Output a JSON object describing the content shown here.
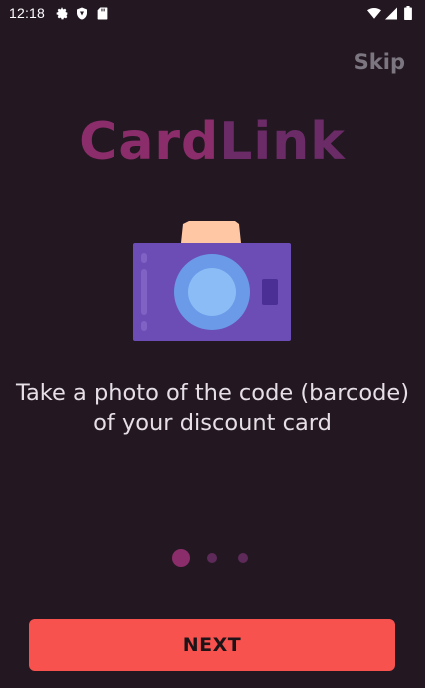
{
  "status_bar": {
    "time": "12:18",
    "left_icons": [
      "gear-icon",
      "shield-icon",
      "sd-card-icon"
    ],
    "right_icons": [
      "wifi-icon",
      "signal-icon",
      "battery-icon"
    ]
  },
  "header": {
    "skip_label": "Skip"
  },
  "logo": {
    "part1": "Card",
    "part2": "Link"
  },
  "illustration": {
    "icon": "camera-icon"
  },
  "onboarding": {
    "description_line1": "Take a photo of the code (barcode)",
    "description_line2": "of your discount card"
  },
  "pager": {
    "total": 3,
    "current": 1
  },
  "actions": {
    "next_label": "NEXT"
  },
  "colors": {
    "background": "#231822",
    "accent": "#f8524f",
    "brand": "#8a2d6a",
    "camera_body": "#6c4cb5",
    "camera_top": "#ffc7a3",
    "lens_outer": "#6a9ae8",
    "lens_inner": "#8cbcf5"
  }
}
